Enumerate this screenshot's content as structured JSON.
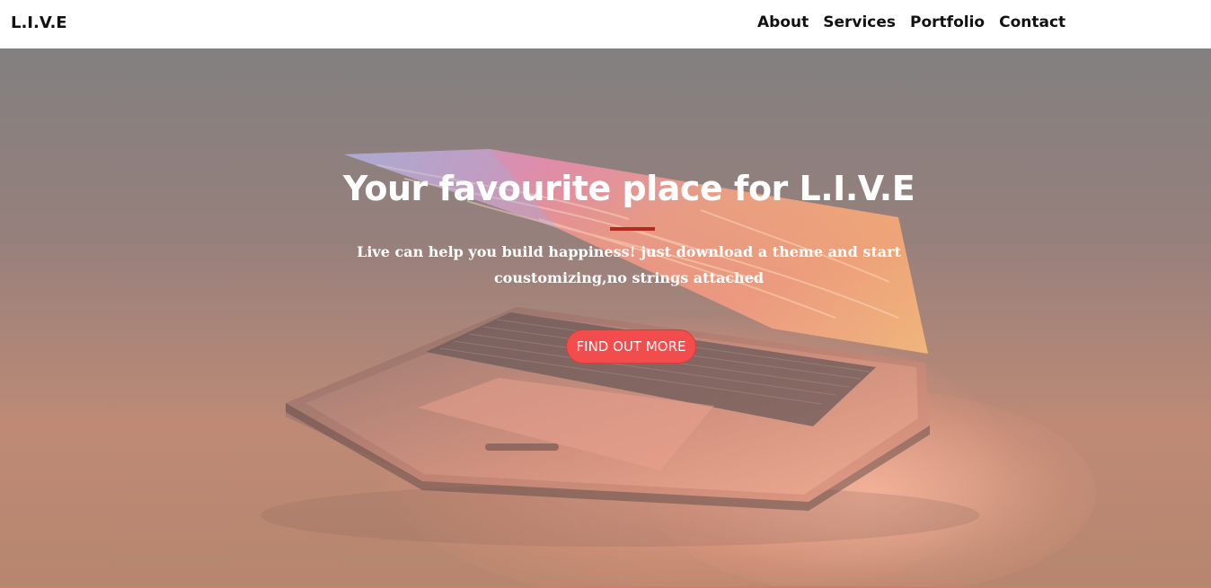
{
  "navbar": {
    "brand": "L.I.V.E",
    "links": [
      "About",
      "Services",
      "Portfolio",
      "Contact"
    ]
  },
  "hero": {
    "title": "Your favourite place for L.I.V.E",
    "subtitle": "Live can help you build happiness! just download a theme and start coustomizing,no strings attached",
    "cta_label": "FIND OUT MORE",
    "background_image": "laptop-image",
    "colors": {
      "overlay": "#868282",
      "accent": "#f24c4c",
      "divider": "#b52a1f"
    }
  }
}
